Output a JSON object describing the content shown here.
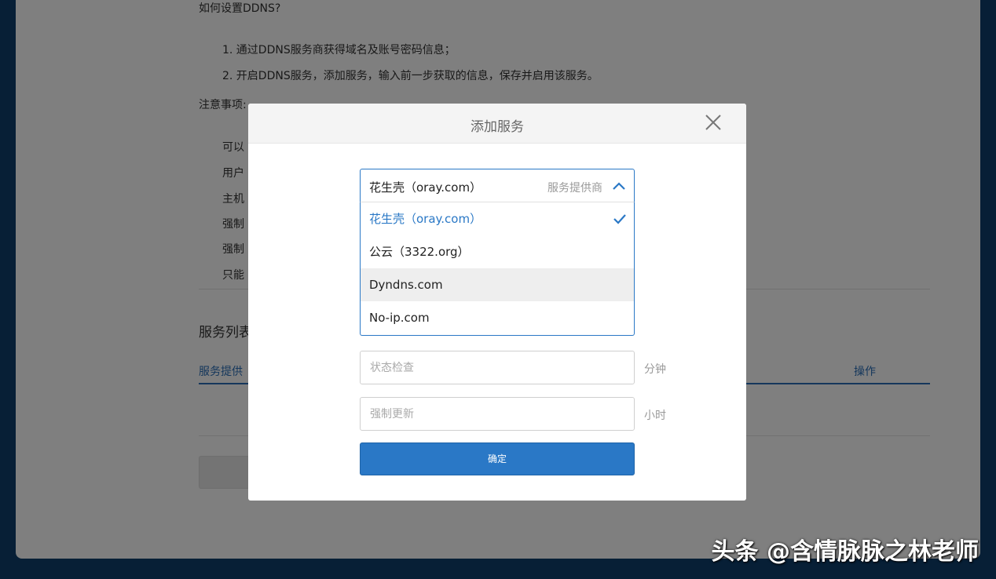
{
  "background": {
    "question": "如何设置DDNS?",
    "steps": [
      "1. 通过DDNS服务商获得域名及账号密码信息；",
      "2. 开启DDNS服务，添加服务，输入前一步获取的信息，保存并启用该服务。"
    ],
    "notes_title": "注意事项:",
    "note_fragments": [
      "可以",
      "用户",
      "主机",
      "强制",
      "强制",
      "只能"
    ],
    "service_list_title": "服务列表",
    "table_col_provider": "服务提供",
    "table_col_action": "操作"
  },
  "modal": {
    "title": "添加服务",
    "provider_select": {
      "value": "花生壳（oray.com）",
      "label": "服务提供商",
      "options": [
        "花生壳（oray.com）",
        "公云（3322.org）",
        "Dyndns.com",
        "No-ip.com"
      ],
      "selected_index": 0,
      "hover_index": 2
    },
    "status_check": {
      "placeholder": "状态检查",
      "unit": "分钟"
    },
    "force_update": {
      "placeholder": "强制更新",
      "unit": "小时"
    },
    "confirm_label": "确定"
  },
  "watermark": "头条 @含情脉脉之林老师",
  "colors": {
    "accent": "#2a78c6",
    "frame": "#0e3e6c",
    "hover_bg": "#eeeeee"
  }
}
